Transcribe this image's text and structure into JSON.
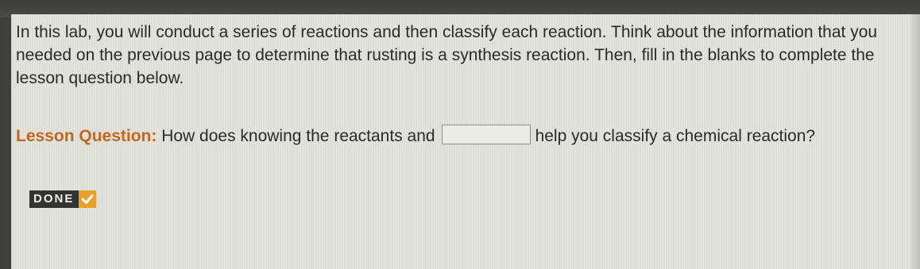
{
  "lesson": {
    "intro": "In this lab, you will conduct a series of reactions and then classify each reaction. Think about the information that you needed on the previous page to determine that rusting is a synthesis reaction. Then, fill in the blanks to complete the lesson question below.",
    "question_label": "Lesson Question:",
    "question_before_blank": " How does knowing the reactants and",
    "question_after_blank": "help you classify a chemical reaction?",
    "blank_value": ""
  },
  "done_button": {
    "label": "DONE",
    "icon": "checkmark-icon",
    "accent_color": "#e9a02a"
  },
  "colors": {
    "question_label": "#c2671f",
    "text": "#2a2a2a",
    "panel": "#e4e4de"
  }
}
